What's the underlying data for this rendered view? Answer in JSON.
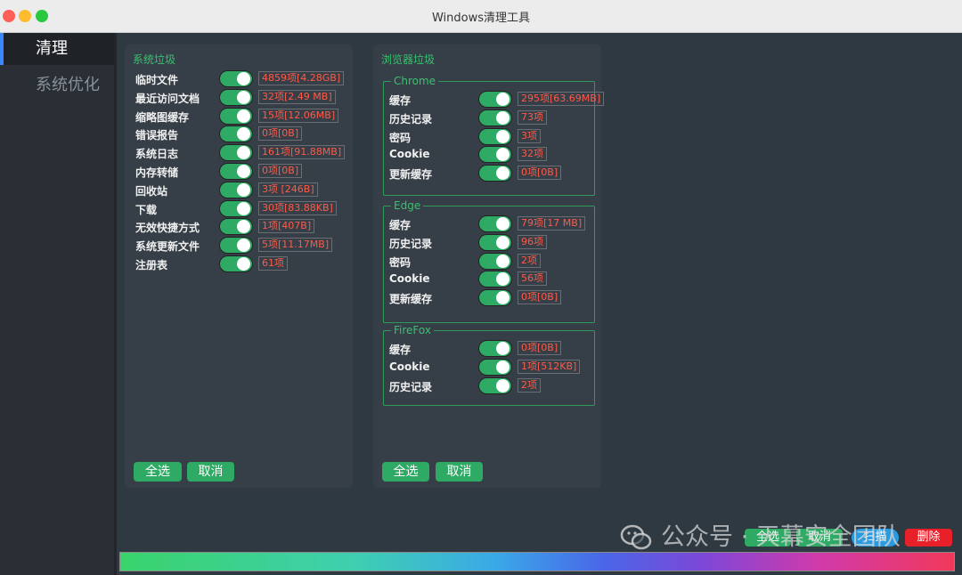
{
  "window": {
    "title": "Windows清理工具"
  },
  "sidebar": {
    "items": [
      {
        "label": "清理",
        "active": true
      },
      {
        "label": "系统优化",
        "active": false
      }
    ]
  },
  "system_panel": {
    "title": "系统垃圾",
    "items": [
      {
        "label": "临时文件",
        "value": "4859项[4.28GB]",
        "enabled": true
      },
      {
        "label": "最近访问文档",
        "value": "32项[2.49 MB]",
        "enabled": true
      },
      {
        "label": "缩略图缓存",
        "value": "15项[12.06MB]",
        "enabled": true
      },
      {
        "label": "错误报告",
        "value": "0项[0B]",
        "enabled": true
      },
      {
        "label": "系统日志",
        "value": "161项[91.88MB]",
        "enabled": true
      },
      {
        "label": "内存转储",
        "value": "0项[0B]",
        "enabled": true
      },
      {
        "label": "回收站",
        "value": "3项 [246B]",
        "enabled": true
      },
      {
        "label": "下载",
        "value": "30项[83.88KB]",
        "enabled": true
      },
      {
        "label": "无效快捷方式",
        "value": "1项[407B]",
        "enabled": true
      },
      {
        "label": "系统更新文件",
        "value": "5项[11.17MB]",
        "enabled": true
      },
      {
        "label": "注册表",
        "value": "61项",
        "enabled": true
      }
    ],
    "select_all": "全选",
    "cancel": "取消"
  },
  "browser_panel": {
    "title": "浏览器垃圾",
    "groups": [
      {
        "name": "Chrome",
        "items": [
          {
            "label": "缓存",
            "value": "295项[63.69MB]",
            "enabled": true
          },
          {
            "label": "历史记录",
            "value": "73项",
            "enabled": true
          },
          {
            "label": "密码",
            "value": "3项",
            "enabled": true
          },
          {
            "label": "Cookie",
            "value": "32项",
            "enabled": true
          },
          {
            "label": "更新缓存",
            "value": "0项[0B]",
            "enabled": true
          }
        ]
      },
      {
        "name": "Edge",
        "items": [
          {
            "label": "缓存",
            "value": "79项[17 MB]",
            "enabled": true
          },
          {
            "label": "历史记录",
            "value": "96项",
            "enabled": true
          },
          {
            "label": "密码",
            "value": "2项",
            "enabled": true
          },
          {
            "label": "Cookie",
            "value": "56项",
            "enabled": true
          },
          {
            "label": "更新缓存",
            "value": "0项[0B]",
            "enabled": true
          }
        ]
      },
      {
        "name": "FireFox",
        "items": [
          {
            "label": "缓存",
            "value": "0项[0B]",
            "enabled": true
          },
          {
            "label": "Cookie",
            "value": "1项[512KB]",
            "enabled": true
          },
          {
            "label": "历史记录",
            "value": "2项",
            "enabled": true
          }
        ]
      }
    ],
    "select_all": "全选",
    "cancel": "取消"
  },
  "bottom_bar": {
    "buttons": [
      {
        "label": "全选",
        "color": "#2faa64"
      },
      {
        "label": "取消",
        "color": "#2faa64"
      },
      {
        "label": "扫描",
        "color": "#2a9be0"
      },
      {
        "label": "删除",
        "color": "#e8202a"
      }
    ],
    "progress": 1.0
  },
  "watermark": {
    "text": "公众号 · 天幕安全团队",
    "icon": "wechat-icon"
  }
}
